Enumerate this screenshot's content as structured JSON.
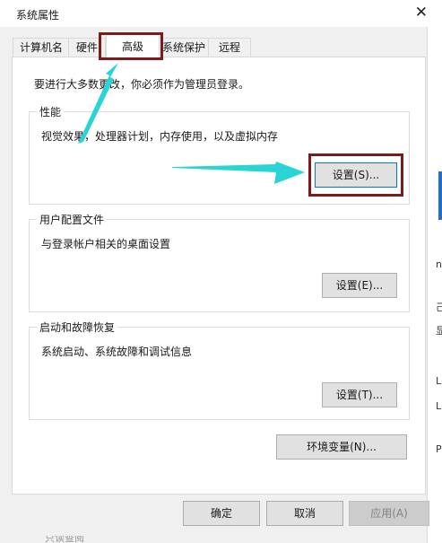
{
  "window": {
    "title": "系统属性",
    "close_glyph": "✕"
  },
  "tabs": [
    {
      "label": "计算机名",
      "active": false
    },
    {
      "label": "硬件",
      "active": false
    },
    {
      "label": "高级",
      "active": true
    },
    {
      "label": "系统保护",
      "active": false
    },
    {
      "label": "远程",
      "active": false
    }
  ],
  "notice": "要进行大多数更改，你必须作为管理员登录。",
  "performance": {
    "title": "性能",
    "description": "视觉效果，处理器计划，内存使用，以及虚拟内存",
    "button": "设置(S)..."
  },
  "user_profiles": {
    "title": "用户配置文件",
    "description": "与登录帐户相关的桌面设置",
    "button": "设置(E)..."
  },
  "startup": {
    "title": "启动和故障恢复",
    "description": "系统启动、系统故障和调试信息",
    "button": "设置(T)..."
  },
  "env_button": "环境变量(N)...",
  "footer": {
    "ok": "确定",
    "cancel": "取消",
    "apply": "应用(A)"
  },
  "behind_fragments": [
    "n",
    "己",
    "显",
    "LE",
    "LE",
    "P"
  ],
  "bottom_fragment": "只读查阅",
  "annotation": {
    "arrow_color": "#29d4d4",
    "box_color": "#7b1c1c"
  }
}
